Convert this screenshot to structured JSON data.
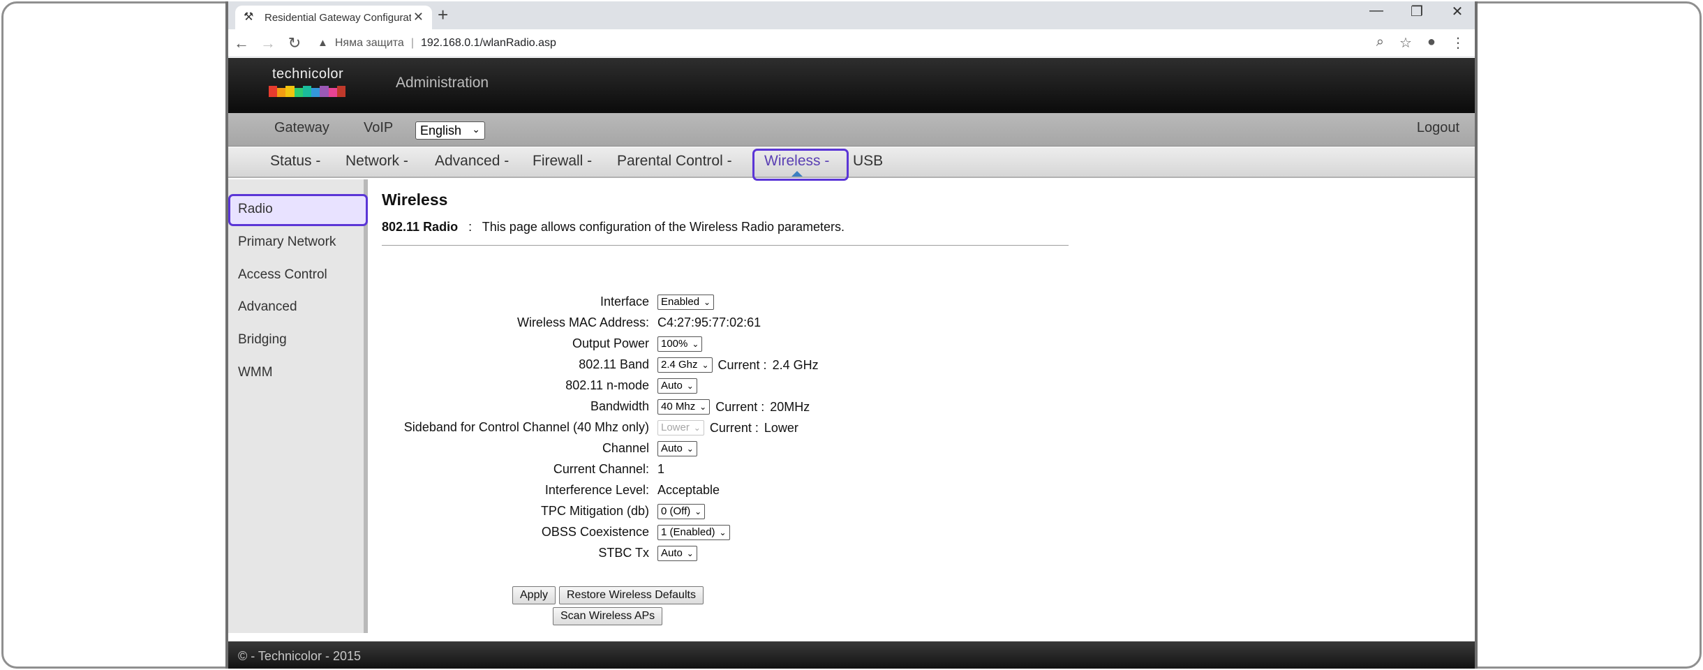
{
  "browser": {
    "tab_title": "Residential Gateway Configuratio",
    "new_tab": "+",
    "close_tab": "✕",
    "window_controls": {
      "minimize": "—",
      "restore": "❐",
      "close": "✕"
    },
    "security_text": "Няма защита",
    "separator": "|",
    "url": "192.168.0.1/wlanRadio.asp"
  },
  "header": {
    "logo_text": "technicolor",
    "logo_colors": [
      "#e63b2e",
      "#f39c12",
      "#f1c40f",
      "#2ecc71",
      "#1abc9c",
      "#3498db",
      "#9b59b6",
      "#e84393",
      "#c0392b"
    ],
    "admin_title": "Administration"
  },
  "topnav": {
    "items": [
      "Gateway",
      "VoIP"
    ],
    "language": "English",
    "logout": "Logout"
  },
  "subnav": {
    "items": [
      "Status -",
      "Network -",
      "Advanced -",
      "Firewall -",
      "Parental Control -",
      "Wireless -",
      "USB"
    ],
    "active": "Wireless -"
  },
  "sidebar": {
    "items": [
      "Radio",
      "Primary Network",
      "Access Control",
      "Advanced",
      "Bridging",
      "WMM"
    ],
    "active": "Radio"
  },
  "content": {
    "title": "Wireless",
    "desc_bold": "802.11 Radio",
    "desc_colon": ":",
    "desc_text": "This page allows configuration of the Wireless Radio parameters.",
    "fields": {
      "interface": {
        "label": "Interface",
        "value": "Enabled"
      },
      "mac": {
        "label": "Wireless MAC Address:",
        "value": "C4:27:95:77:02:61"
      },
      "output_power": {
        "label": "Output Power",
        "value": "100%"
      },
      "band": {
        "label": "802.11 Band",
        "value": "2.4 Ghz",
        "current_label": "Current :",
        "current_value": "2.4 GHz"
      },
      "nmode": {
        "label": "802.11 n-mode",
        "value": "Auto"
      },
      "bandwidth": {
        "label": "Bandwidth",
        "value": "40 Mhz",
        "current_label": "Current :",
        "current_value": "20MHz"
      },
      "sideband": {
        "label": "Sideband for Control Channel (40 Mhz only)",
        "value": "Lower",
        "current_label": "Current :",
        "current_value": "Lower"
      },
      "channel": {
        "label": "Channel",
        "value": "Auto"
      },
      "current_channel": {
        "label": "Current Channel:",
        "value": "1"
      },
      "interference": {
        "label": "Interference Level:",
        "value": "Acceptable"
      },
      "tpc": {
        "label": "TPC Mitigation (db)",
        "value": "0 (Off)"
      },
      "obss": {
        "label": "OBSS Coexistence",
        "value": "1 (Enabled)"
      },
      "stbc": {
        "label": "STBC Tx",
        "value": "Auto"
      }
    },
    "buttons": {
      "apply": "Apply",
      "restore": "Restore Wireless Defaults",
      "scan": "Scan Wireless APs"
    }
  },
  "footer": {
    "text": "© - Technicolor - 2015"
  }
}
